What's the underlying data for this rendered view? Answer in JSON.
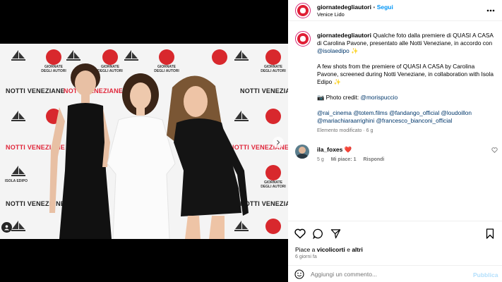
{
  "colors": {
    "accent": "#0095f6",
    "heart": "#ed4956",
    "muted": "#737373",
    "link": "#00376b"
  },
  "photo": {
    "wall_brand_a": "NOTTI VENEZIANE",
    "logo_label": "GIORNATE DEGLI AUTORI",
    "boat_label": "ISOLA EDIPO"
  },
  "header": {
    "username": "giornatedegliautori",
    "separator": "•",
    "follow_label": "Segui",
    "location": "Venice Lido",
    "more_icon": "more-horizontal-icon"
  },
  "caption": {
    "username": "giornatedegliautori",
    "text_it_1": " Qualche foto dalla premiere di QUASI A CASA di Carolina Pavone, presentato alle Notti Veneziane, in accordo con ",
    "mention_it": "@isolaedipo",
    "sparkle": " ✨",
    "text_en": "A few shots from the premiere of QUASI A CASA by Carolina Pavone, screened during Notti Veneziane, in collaboration with Isola Edipo ✨",
    "credit_prefix": "📷 Photo credit: ",
    "credit_mention": "@morispuccio",
    "tags_line1": [
      "@rai_cinema",
      "@totem.films",
      "@fandango_official",
      "@loudoillon"
    ],
    "tags_line2": [
      "@mariachiaraarrighini",
      "@francesco_bianconi_official"
    ],
    "edited": "Elemento modificato",
    "edited_sep": " · ",
    "edited_time": "6 g"
  },
  "comment": {
    "username": "ila_foxes",
    "text": " ❤️",
    "time": "5 g",
    "likes": "Mi piace: 1",
    "reply": "Rispondi"
  },
  "actions": {
    "likes_prefix": "Piace a ",
    "likes_user": "vicolicorti",
    "likes_mid": " e ",
    "likes_others": "altri",
    "post_time": "6 giorni fa"
  },
  "add_comment": {
    "placeholder": "Aggiungi un commento...",
    "publish": "Pubblica"
  }
}
